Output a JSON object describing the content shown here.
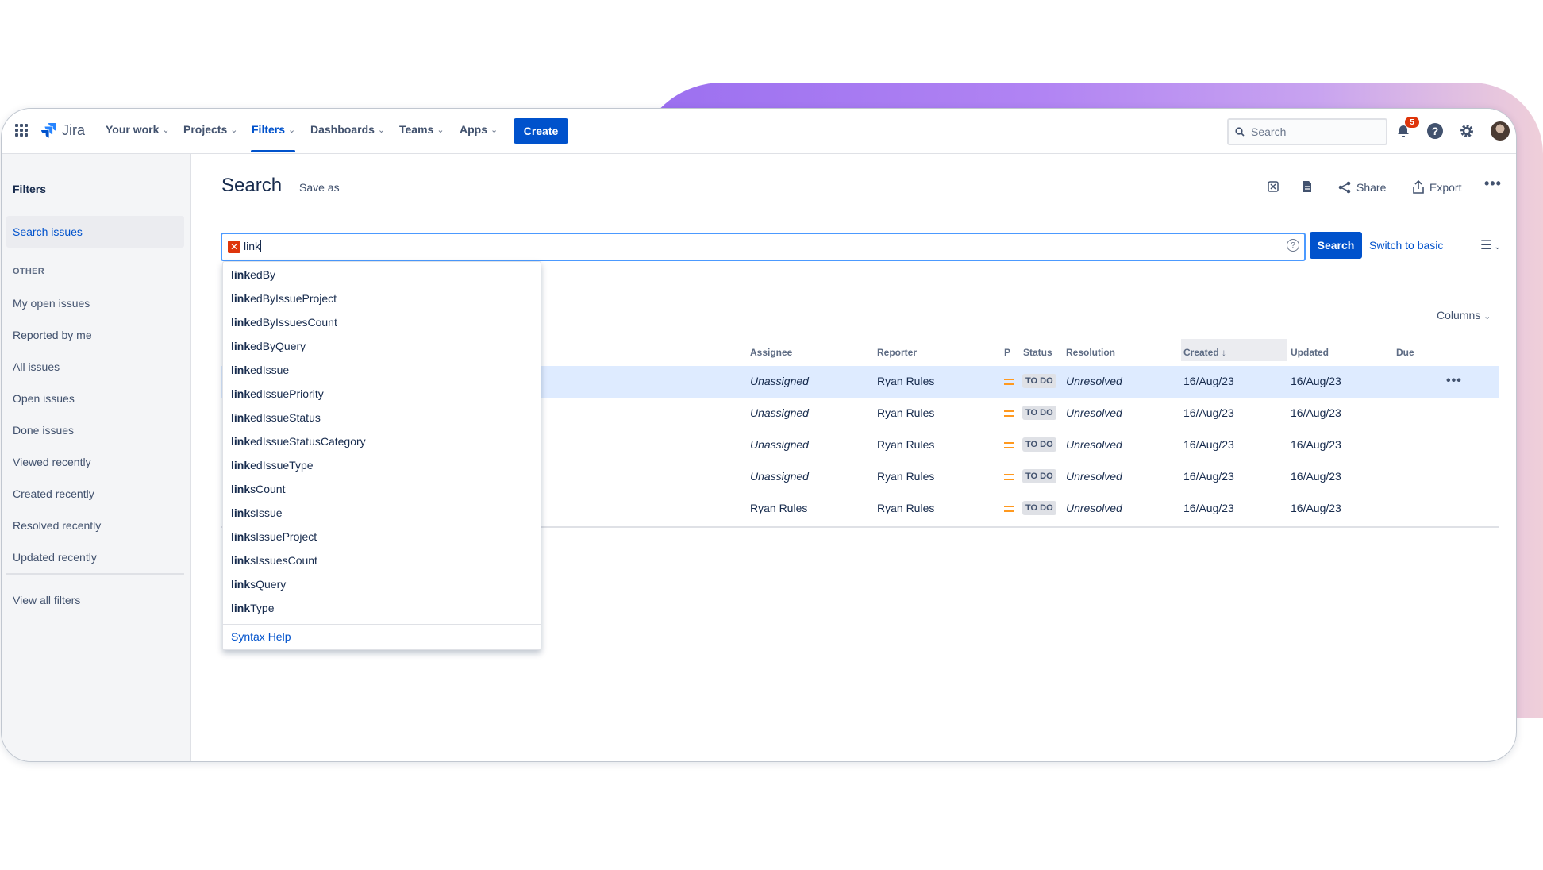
{
  "nav": {
    "logo": "Jira",
    "items": [
      {
        "label": "Your work"
      },
      {
        "label": "Projects"
      },
      {
        "label": "Filters"
      },
      {
        "label": "Dashboards"
      },
      {
        "label": "Teams"
      },
      {
        "label": "Apps"
      }
    ],
    "create_label": "Create",
    "search_placeholder": "Search",
    "notification_count": "5"
  },
  "sidebar": {
    "title": "Filters",
    "selected": "Search issues",
    "section_label": "OTHER",
    "items": [
      "My open issues",
      "Reported by me",
      "All issues",
      "Open issues",
      "Done issues",
      "Viewed recently",
      "Created recently",
      "Resolved recently",
      "Updated recently"
    ],
    "view_all": "View all filters"
  },
  "main": {
    "title": "Search",
    "save_as": "Save as",
    "share_label": "Share",
    "export_label": "Export",
    "jql_value": "link",
    "search_button": "Search",
    "switch_basic": "Switch to basic",
    "columns_label": "Columns"
  },
  "autocomplete": {
    "prefix": "link",
    "suggestions": [
      "edBy",
      "edByIssueProject",
      "edByIssuesCount",
      "edByQuery",
      "edIssue",
      "edIssuePriority",
      "edIssueStatus",
      "edIssueStatusCategory",
      "edIssueType",
      "sCount",
      "sIssue",
      "sIssueProject",
      "sIssuesCount",
      "sQuery",
      "Type"
    ],
    "syntax_help": "Syntax Help"
  },
  "table": {
    "headers": {
      "assignee": "Assignee",
      "reporter": "Reporter",
      "priority": "P",
      "status": "Status",
      "resolution": "Resolution",
      "created": "Created",
      "updated": "Updated",
      "due": "Due"
    },
    "rows": [
      {
        "assignee": "Unassigned",
        "reporter": "Ryan Rules",
        "status": "TO DO",
        "resolution": "Unresolved",
        "created": "16/Aug/23",
        "updated": "16/Aug/23"
      },
      {
        "assignee": "Unassigned",
        "reporter": "Ryan Rules",
        "status": "TO DO",
        "resolution": "Unresolved",
        "created": "16/Aug/23",
        "updated": "16/Aug/23"
      },
      {
        "assignee": "Unassigned",
        "reporter": "Ryan Rules",
        "status": "TO DO",
        "resolution": "Unresolved",
        "created": "16/Aug/23",
        "updated": "16/Aug/23"
      },
      {
        "assignee": "Unassigned",
        "reporter": "Ryan Rules",
        "status": "TO DO",
        "resolution": "Unresolved",
        "created": "16/Aug/23",
        "updated": "16/Aug/23"
      },
      {
        "assignee": "Ryan Rules",
        "reporter": "Ryan Rules",
        "status": "TO DO",
        "resolution": "Unresolved",
        "created": "16/Aug/23",
        "updated": "16/Aug/23"
      }
    ]
  },
  "icons": [
    "app-switcher-icon",
    "jira-logo-icon",
    "search-icon",
    "bell-icon",
    "help-icon",
    "gear-icon",
    "excel-icon",
    "document-icon",
    "share-icon",
    "export-icon",
    "more-icon",
    "error-icon",
    "list-view-icon"
  ],
  "colors": {
    "brand": "#0052cc",
    "error": "#de350b",
    "priority_medium": "#ff991f",
    "selection": "#deebff"
  }
}
